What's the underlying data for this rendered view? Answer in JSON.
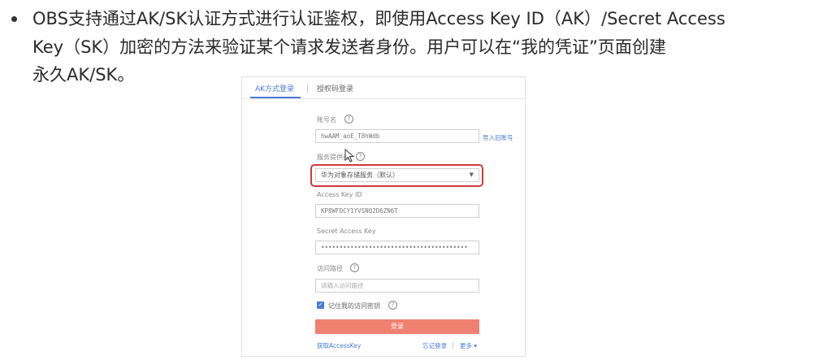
{
  "paragraph": {
    "lines": [
      "OBS支持通过AK/SK认证方式进行认证鉴权，即使用Access Key ID（AK）/Secret Access",
      "Key（SK）加密的方法来验证某个请求发送者身份。用户可以在“我的凭证”页面创建",
      "永久AK/SK。"
    ]
  },
  "login_card": {
    "tabs": [
      "AK方式登录",
      "授权码登录"
    ],
    "account_label": "账号名",
    "account_value": "hwAAM_aoE_T8hWdb",
    "import_link": "导入旧账号",
    "service_label": "服务提供商",
    "service_selected": "华为对象存储服务（默认）",
    "ak_label": "Access Key ID",
    "ak_value": "KP8WFDCY1YVSNQ2D6ZN6T",
    "sk_label": "Secret Access Key",
    "sk_value": "••••••••••••••••••••••••••••••••••••••••",
    "path_label": "访问路径",
    "path_placeholder": "请输入访问路径",
    "remember_label": "记住我的访问密钥",
    "login_button": "登录",
    "get_ak_link": "获取AccessKey",
    "forget_login_link": "忘记登录",
    "more_link": "更多 ▾",
    "accent_color": "#4a7bd6",
    "button_color": "#f08070",
    "highlight_color": "#d23a3a"
  }
}
